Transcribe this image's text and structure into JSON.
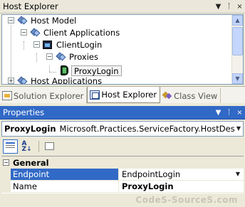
{
  "host_explorer": {
    "title": "Host Explorer",
    "controls": [
      "▼",
      "ᛙ",
      "×"
    ],
    "tree": [
      {
        "label": "Host Model",
        "icon": "host-model-icon"
      },
      {
        "label": "Client Applications",
        "icon": "diamond-icon"
      },
      {
        "label": "ClientLogin",
        "icon": "application-icon"
      },
      {
        "label": "Proxies",
        "icon": "diamond-icon"
      },
      {
        "label": "ProxyLogin",
        "icon": "proxy-icon",
        "selected": true
      },
      {
        "label": "Host Applications",
        "icon": "diamond-icon"
      }
    ]
  },
  "tabs": [
    {
      "label": "Solution Explorer",
      "icon": "solution-explorer-icon"
    },
    {
      "label": "Host Explorer",
      "icon": "host-explorer-icon",
      "active": true
    },
    {
      "label": "Class View",
      "icon": "class-view-icon"
    }
  ],
  "properties": {
    "title": "Properties",
    "controls": [
      "▼",
      "ᛙ",
      "×"
    ],
    "object_name": "ProxyLogin",
    "object_type": "Microsoft.Practices.ServiceFactory.HostDesigner.Pro:",
    "category": "General",
    "rows": [
      {
        "name": "Endpoint",
        "value": "EndpointLogin",
        "selected": true
      },
      {
        "name": "Name",
        "value": "ProxyLogin"
      }
    ]
  },
  "watermark": "CodeS-SourceS.com"
}
